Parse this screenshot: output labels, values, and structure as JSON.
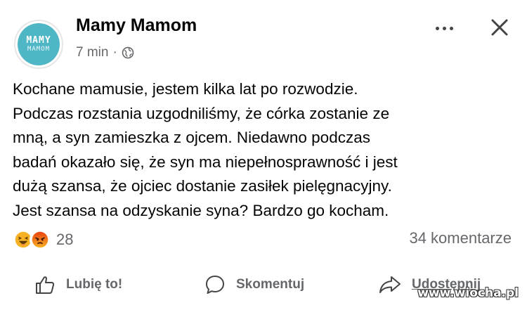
{
  "post": {
    "author": "Mamy Mamom",
    "avatar_text_top": "MAMY",
    "avatar_text_bottom": "MAMOM",
    "time": "7 min",
    "separator": "·",
    "privacy_icon": "globe-icon",
    "text_lines": [
      "Kochane mamusie, jestem kilka lat po rozwodzie.",
      "Podczas rozstania uzgodniliśmy, że córka zostanie ze",
      "mną, a syn zamieszka z ojcem. Niedawno podczas",
      "badań okazało się, że syn ma niepełnosprawność i jest",
      "dużą szansa, że ojciec dostanie zasiłek pielęgnacyjny.",
      "Jest szansa na odzyskanie syna? Bardzo go kocham."
    ]
  },
  "header_actions": {
    "more_icon": "more-dots-icon",
    "close_icon": "close-icon"
  },
  "reactions": {
    "icons": [
      "haha-reaction-icon",
      "angry-reaction-icon"
    ],
    "count": "28"
  },
  "comments_count": "34 komentarze",
  "actions": {
    "like": "Lubię to!",
    "comment": "Skomentuj",
    "share": "Udostępnij"
  },
  "watermark": "www.wiocha.pl",
  "colors": {
    "text": "#050505",
    "muted": "#65676b",
    "avatar_bg": "#4fb6c6",
    "haha": "#f7b125",
    "angry": "#e9710f"
  }
}
